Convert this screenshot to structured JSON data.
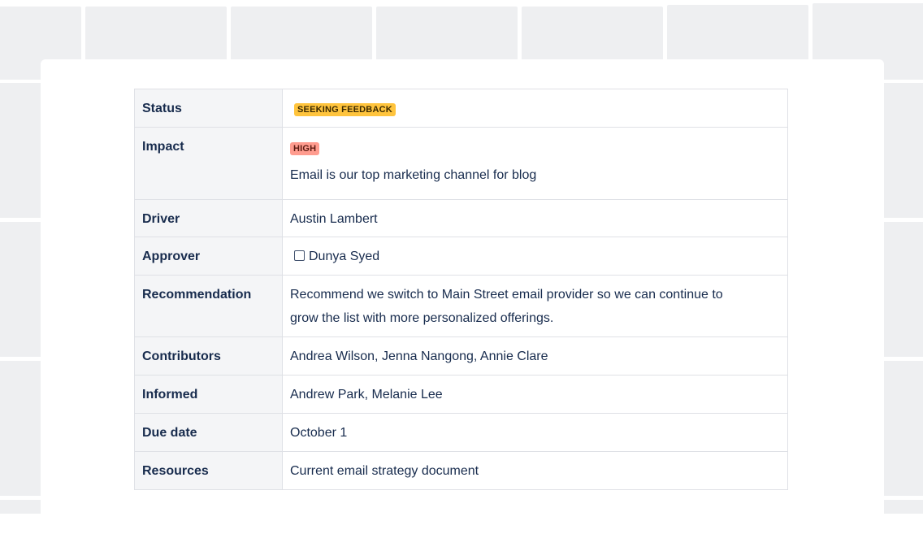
{
  "theme": {
    "lozenge_yellow": "#ffc43d",
    "lozenge_red": "#ff9c8f",
    "label_bg": "#f4f5f7",
    "border": "#dfe1e6",
    "text": "#172b4d"
  },
  "rows": {
    "status": {
      "label": "Status",
      "lozenge": "SEEKING FEEDBACK"
    },
    "impact": {
      "label": "Impact",
      "lozenge": "HIGH",
      "text": "Email is our top marketing channel for blog"
    },
    "driver": {
      "label": "Driver",
      "value": "Austin Lambert"
    },
    "approver": {
      "label": "Approver",
      "value": "Dunya Syed",
      "checked": false
    },
    "recommendation": {
      "label": "Recommendation",
      "line1": "Recommend we switch to Main Street email provider so we can continue to",
      "line2": "grow the list with more personalized offerings."
    },
    "contributors": {
      "label": "Contributors",
      "value": "Andrea Wilson, Jenna Nangong, Annie Clare"
    },
    "informed": {
      "label": "Informed",
      "value": "Andrew Park, Melanie Lee"
    },
    "due_date": {
      "label": "Due date",
      "value": "October 1"
    },
    "resources": {
      "label": "Resources",
      "value": "Current email strategy document"
    }
  }
}
